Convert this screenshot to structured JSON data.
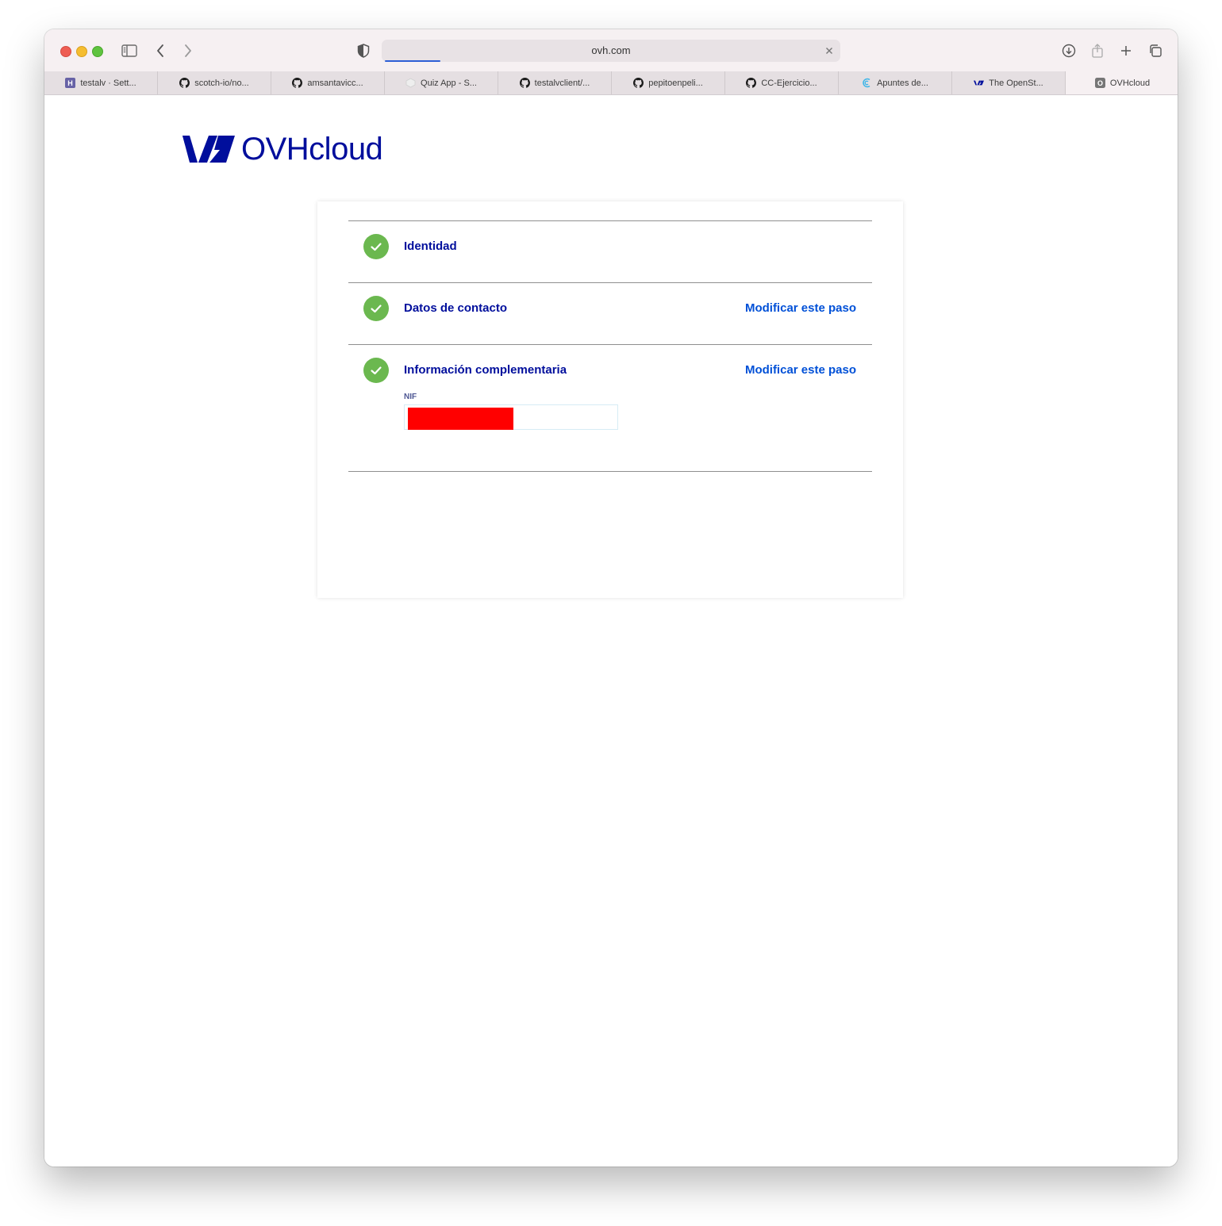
{
  "browser": {
    "address": "ovh.com",
    "tabs": [
      {
        "label": "testalv · Sett...",
        "icon": "heroku-icon"
      },
      {
        "label": "scotch-io/no...",
        "icon": "github-icon"
      },
      {
        "label": "amsantavicc...",
        "icon": "github-icon"
      },
      {
        "label": "Quiz App - S...",
        "icon": "quiz-app-icon"
      },
      {
        "label": "testalvclient/...",
        "icon": "github-icon"
      },
      {
        "label": "pepitoenpeli...",
        "icon": "github-icon"
      },
      {
        "label": "CC-Ejercicio...",
        "icon": "github-icon"
      },
      {
        "label": "Apuntes de...",
        "icon": "apuntes-icon"
      },
      {
        "label": "The OpenSt...",
        "icon": "ovh-icon"
      },
      {
        "label": "OVHcloud",
        "icon": "ovhcloud-icon"
      }
    ],
    "active_tab_index": 9
  },
  "logo": {
    "text": "OVHcloud"
  },
  "steps": [
    {
      "title": "Identidad",
      "link": ""
    },
    {
      "title": "Datos de contacto",
      "link": "Modificar este paso"
    },
    {
      "title": "Información complementaria",
      "link": "Modificar este paso"
    }
  ],
  "nif": {
    "label": "NIF"
  },
  "colors": {
    "brand": "#000e9c",
    "link": "#0050d7",
    "check": "#6bb84f",
    "redaction": "#ff0000"
  }
}
